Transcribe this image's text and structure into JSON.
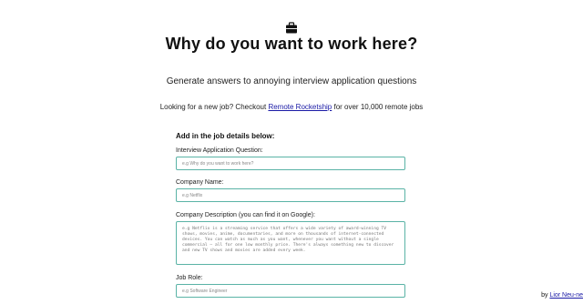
{
  "header": {
    "icon": "briefcase-icon",
    "title": "Why do you want to work here?",
    "subtitle": "Generate answers to annoying interview application questions"
  },
  "promo": {
    "prefix": "Looking for a new job? Checkout ",
    "link_text": "Remote Rocketship",
    "suffix": " for over 10,000 remote jobs"
  },
  "form": {
    "heading": "Add in the job details below:",
    "question_label": "Interview Application Question:",
    "question_placeholder": "e.g Why do you want to work here?",
    "company_label": "Company Name:",
    "company_placeholder": "e.g Netflix",
    "description_label": "Company Description (you can find it on Google):",
    "description_placeholder": "e.g Netflix is a streaming service that offers a wide variety of award-winning TV shows, movies, anime, documentaries, and more on thousands of internet-connected devices. You can watch as much as you want, whenever you want without a single commercial – all for one low monthly price. There's always something new to discover and new TV shows and movies are added every week.",
    "role_label": "Job Role:",
    "role_placeholder": "e.g Software Engineer"
  },
  "footer": {
    "by_text": "by ",
    "author_link": "Lior Neu-ne"
  }
}
